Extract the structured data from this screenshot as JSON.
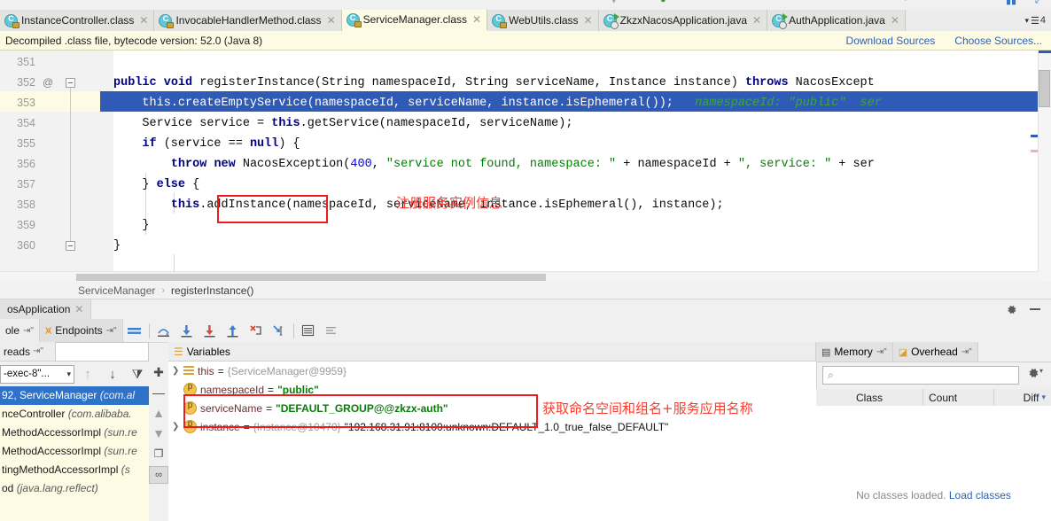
{
  "window": {
    "tab_overflow_count": "4"
  },
  "editor_tabs": [
    {
      "label": "InstanceController.class",
      "icon": "class-file-icon",
      "active": false
    },
    {
      "label": "InvocableHandlerMethod.class",
      "icon": "class-file-icon",
      "active": false
    },
    {
      "label": "ServiceManager.class",
      "icon": "class-file-icon",
      "active": true
    },
    {
      "label": "WebUtils.class",
      "icon": "class-file-icon",
      "active": false
    },
    {
      "label": "ZkzxNacosApplication.java",
      "icon": "java-runnable-icon",
      "active": false
    },
    {
      "label": "AuthApplication.java",
      "icon": "java-runnable-icon",
      "active": false
    }
  ],
  "notice": {
    "text": "Decompiled .class file, bytecode version: 52.0 (Java 8)",
    "download_sources": "Download Sources",
    "choose_sources": "Choose Sources..."
  },
  "code": {
    "lines": [
      {
        "number": "351",
        "text": ""
      },
      {
        "number": "352",
        "text": "public void registerInstance(String namespaceId, String serviceName, Instance instance) throws NacosExcept",
        "gutter_marker": "@",
        "foldable": true
      },
      {
        "number": "353",
        "text": "    this.createEmptyService(namespaceId, serviceName, instance.isEphemeral());",
        "hint": "namespaceId: \"public\"  ser",
        "selected": true
      },
      {
        "number": "354",
        "text": "    Service service = this.getService(namespaceId, serviceName);"
      },
      {
        "number": "355",
        "text": "    if (service == null) {"
      },
      {
        "number": "356",
        "text": "        throw new NacosException(400, \"service not found, namespace: \" + namespaceId + \", service: \" + ser"
      },
      {
        "number": "357",
        "text": "    } else {"
      },
      {
        "number": "358",
        "text": "        this.addInstance(namespaceId, serviceName, instance.isEphemeral(), instance);"
      },
      {
        "number": "359",
        "text": "    }"
      },
      {
        "number": "360",
        "text": "}",
        "foldable": true
      }
    ],
    "annotation": "注册服务实例信息",
    "annotation_highlight": ".addInstance"
  },
  "breadcrumb": {
    "class": "ServiceManager",
    "separator": "›",
    "method": "registerInstance()"
  },
  "debug": {
    "tabs": [
      {
        "label": "osApplication",
        "closable": true
      }
    ],
    "left_buttons": [
      {
        "label": "ole",
        "icon": "console-icon"
      },
      {
        "label": "Endpoints",
        "icon": "endpoints-icon"
      }
    ],
    "toolbar_icons": [
      "show-execution-point-icon",
      "step-over-icon",
      "step-into-icon",
      "force-step-into-icon",
      "step-out-icon",
      "drop-frame-icon",
      "run-to-cursor-icon",
      "evaluate-expression-icon",
      "mute-breakpoints-icon"
    ],
    "frames": {
      "header": "reads",
      "thread_selector": "-exec-8\"...",
      "items": [
        {
          "text": "92, ServiceManager ",
          "detail": "(com.al",
          "selected": true
        },
        {
          "text": "nceController ",
          "detail": "(com.alibaba.",
          "selected": false
        },
        {
          "text": "MethodAccessorImpl ",
          "detail": "(sun.re",
          "selected": false
        },
        {
          "text": "MethodAccessorImpl ",
          "detail": "(sun.re",
          "selected": false
        },
        {
          "text": "tingMethodAccessorImpl ",
          "detail": "(s",
          "selected": false
        },
        {
          "text": "od ",
          "detail": "(java.lang.reflect)",
          "selected": false
        }
      ]
    },
    "variables": {
      "title": "Variables",
      "rows": [
        {
          "name": "this",
          "eq": "=",
          "ref": "{ServiceManager@9959}",
          "value": "",
          "kind": "object",
          "expandable": true
        },
        {
          "name": "namespaceId",
          "eq": "=",
          "ref": "",
          "value": "\"public\"",
          "kind": "field",
          "expandable": false
        },
        {
          "name": "serviceName",
          "eq": "=",
          "ref": "",
          "value": "\"DEFAULT_GROUP@@zkzx-auth\"",
          "kind": "field",
          "expandable": false
        },
        {
          "name": "instance",
          "eq": "=",
          "ref": "{Instance@10470}",
          "value": "\"192.168.31.91:8100:unknown:DEFAULT_1.0_true_false_DEFAULT\"",
          "kind": "field",
          "expandable": true
        }
      ],
      "annotation": "获取命名空间和组名+服务应用名称"
    },
    "memory": {
      "tabs": [
        {
          "label": "Memory",
          "icon": "memory-icon"
        },
        {
          "label": "Overhead",
          "icon": "overhead-icon"
        }
      ],
      "search_placeholder": "",
      "columns": [
        "Class",
        "Count",
        "Diff"
      ],
      "empty_text": "No classes loaded.",
      "empty_link": "Load classes"
    }
  },
  "colors": {
    "selection_blue": "#2f5bb7",
    "annotation_red": "#ee1c1c",
    "string_green": "#008000",
    "keyword_navy": "#000080",
    "link_blue": "#2c61b8",
    "highlight_yellow": "#fdfbe4"
  }
}
